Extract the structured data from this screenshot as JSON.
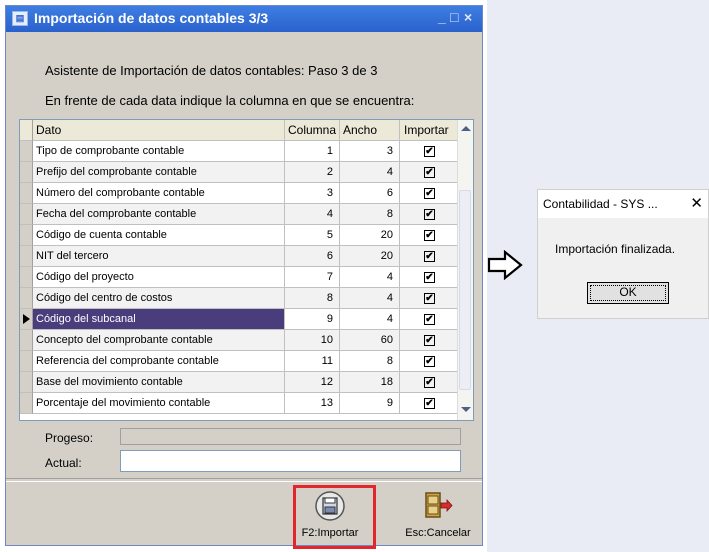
{
  "window": {
    "title": "Importación de datos contables 3/3",
    "minimize_glyph": "_",
    "maximize_glyph": "□",
    "close_glyph": "×"
  },
  "info": {
    "line1": "Asistente de Importación de datos contables: Paso 3 de 3",
    "line2": "En frente de cada data indique la columna en que se encuentra:"
  },
  "grid": {
    "headers": {
      "dato": "Dato",
      "columna": "Columna",
      "ancho": "Ancho",
      "importar": "Importar"
    },
    "rows": [
      {
        "dato": "Tipo de comprobante contable",
        "columna": "1",
        "ancho": "3",
        "importar": true
      },
      {
        "dato": "Prefijo del comprobante contable",
        "columna": "2",
        "ancho": "4",
        "importar": true
      },
      {
        "dato": "Número del comprobante contable",
        "columna": "3",
        "ancho": "6",
        "importar": true
      },
      {
        "dato": "Fecha del comprobante contable",
        "columna": "4",
        "ancho": "8",
        "importar": true
      },
      {
        "dato": "Código de cuenta contable",
        "columna": "5",
        "ancho": "20",
        "importar": true
      },
      {
        "dato": "NIT del tercero",
        "columna": "6",
        "ancho": "20",
        "importar": true
      },
      {
        "dato": "Código del proyecto",
        "columna": "7",
        "ancho": "4",
        "importar": true
      },
      {
        "dato": "Código del centro de costos",
        "columna": "8",
        "ancho": "4",
        "importar": true
      },
      {
        "dato": "Código del subcanal",
        "columna": "9",
        "ancho": "4",
        "importar": true
      },
      {
        "dato": "Concepto del comprobante contable",
        "columna": "10",
        "ancho": "60",
        "importar": true
      },
      {
        "dato": "Referencia del comprobante contable",
        "columna": "11",
        "ancho": "8",
        "importar": true
      },
      {
        "dato": "Base del movimiento contable",
        "columna": "12",
        "ancho": "18",
        "importar": true
      },
      {
        "dato": "Porcentaje del movimiento contable",
        "columna": "13",
        "ancho": "9",
        "importar": true
      }
    ],
    "selected_row": 8,
    "check_glyph": "✔"
  },
  "fields": {
    "progreso_label": "Progeso:",
    "progreso_value": 0,
    "actual_label": "Actual:",
    "actual_value": ""
  },
  "buttons": {
    "importar_label": "F2:Importar",
    "cancelar_label": "Esc:Cancelar"
  },
  "dialog": {
    "title": "Contabilidad - SYS ...",
    "message": "Importación finalizada.",
    "ok_label": "OK",
    "close_glyph": "✕"
  },
  "colors": {
    "titlebar": "#2a61cc",
    "selection": "#4a3d7c",
    "highlight_box": "#e3262b"
  }
}
